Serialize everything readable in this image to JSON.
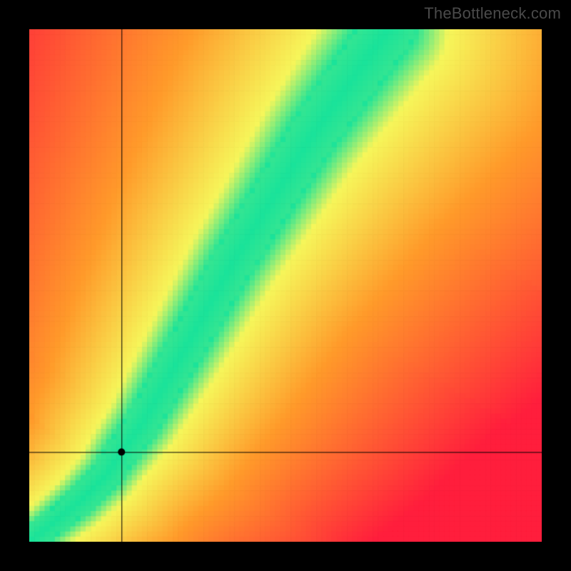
{
  "watermark": "TheBottleneck.com",
  "chart_data": {
    "type": "heatmap",
    "title": "",
    "xlabel": "",
    "ylabel": "",
    "xlim": [
      0,
      100
    ],
    "ylim": [
      0,
      100
    ],
    "crosshair": {
      "x": 18,
      "y": 17.5
    },
    "marker": {
      "x": 18,
      "y": 17.5
    },
    "optimal_curve": {
      "description": "Green band showing balanced pairing; points plotted as [x, y] in chart-axis units",
      "points": [
        [
          0,
          0
        ],
        [
          5,
          4
        ],
        [
          10,
          8
        ],
        [
          15,
          13
        ],
        [
          18,
          17.5
        ],
        [
          22,
          23
        ],
        [
          26,
          30
        ],
        [
          30,
          37
        ],
        [
          35,
          46
        ],
        [
          40,
          55
        ],
        [
          45,
          63
        ],
        [
          50,
          71
        ],
        [
          55,
          79
        ],
        [
          60,
          86
        ],
        [
          65,
          93
        ],
        [
          70,
          100
        ]
      ],
      "band_half_width_start": 2.0,
      "band_half_width_end": 5.0
    },
    "color_scale": {
      "optimal": "#19e39a",
      "near": "#f6f65a",
      "mid": "#ff9a2a",
      "far": "#ff1e3c"
    },
    "pixelation": 100
  }
}
